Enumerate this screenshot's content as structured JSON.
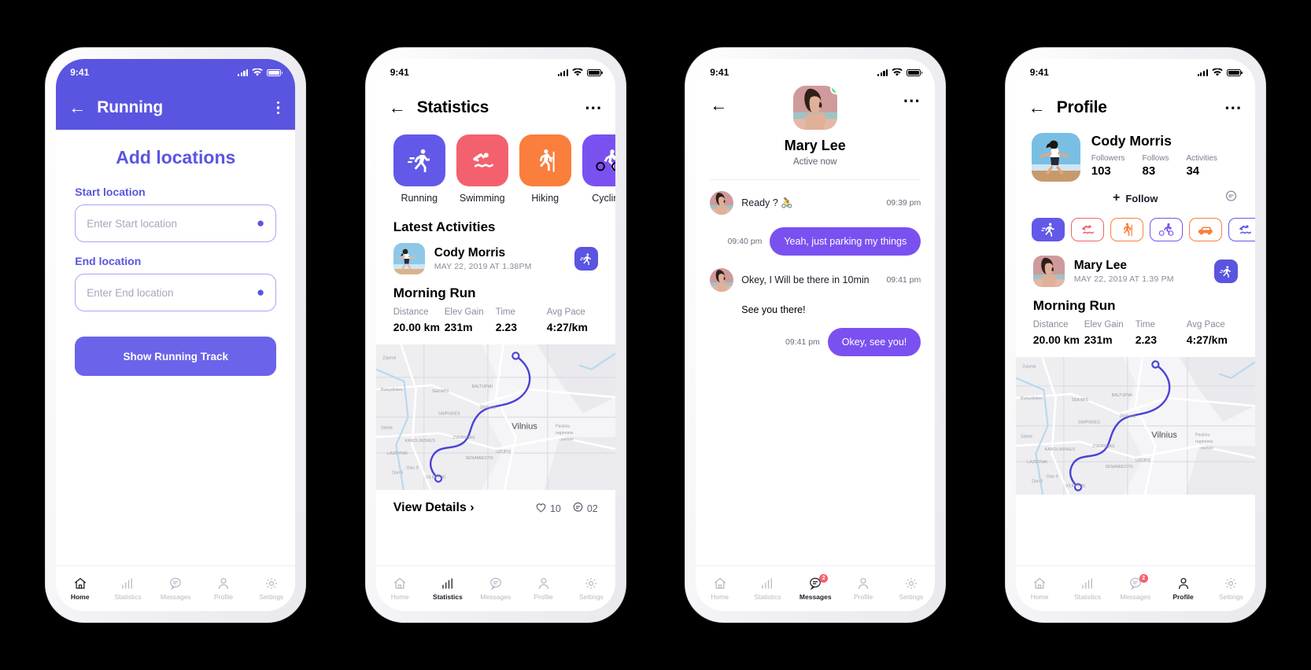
{
  "theme": {
    "primary": "#5a55e0",
    "button": "#6b63ea",
    "bubble": "#7a51f0",
    "red": "#f4616e",
    "orange": "#fa7e3c",
    "online": "#3ce68b"
  },
  "status_bar": {
    "time": "9:41"
  },
  "phone1": {
    "appbar": {
      "title": "Running"
    },
    "heading": "Add locations",
    "fields": [
      {
        "label": "Start location",
        "placeholder": "Enter Start location",
        "value": ""
      },
      {
        "label": "End location",
        "placeholder": "Enter End location",
        "value": ""
      }
    ],
    "submit_label": "Show Running Track",
    "nav": [
      {
        "label": "Home",
        "icon": "home-icon",
        "active": true
      },
      {
        "label": "Statistics",
        "icon": "bar-chart-icon",
        "active": false
      },
      {
        "label": "Messages",
        "icon": "chat-icon",
        "active": false
      },
      {
        "label": "Profile",
        "icon": "person-icon",
        "active": false
      },
      {
        "label": "Settings",
        "icon": "gear-icon",
        "active": false
      }
    ]
  },
  "phone2": {
    "appbar": {
      "title": "Statistics"
    },
    "categories": [
      {
        "label": "Running",
        "icon": "running-icon",
        "color": "#6259e8"
      },
      {
        "label": "Swimming",
        "icon": "swimming-icon",
        "color": "#f4616e"
      },
      {
        "label": "Hiking",
        "icon": "hiking-icon",
        "color": "#fa7e3c"
      },
      {
        "label": "Cycling",
        "icon": "cycling-icon",
        "color": "#7a51f0"
      }
    ],
    "section_title": "Latest Activities",
    "activity": {
      "user": "Cody Morris",
      "date": "MAY 22, 2019 AT 1.38PM",
      "type_icon": "running-icon",
      "title": "Morning Run",
      "stats": [
        {
          "key": "Distance",
          "value": "20.00 km"
        },
        {
          "key": "Elev Gain",
          "value": "231m"
        },
        {
          "key": "Time",
          "value": "2.23"
        },
        {
          "key": "Avg Pace",
          "value": "4:27/km"
        }
      ],
      "map_label": "Vilnius",
      "view_details": "View Details",
      "likes": "10",
      "comments": "02"
    },
    "nav": [
      {
        "label": "Home",
        "icon": "home-icon",
        "active": false
      },
      {
        "label": "Statistics",
        "icon": "bar-chart-icon",
        "active": true
      },
      {
        "label": "Messages",
        "icon": "chat-icon",
        "active": false
      },
      {
        "label": "Profile",
        "icon": "person-icon",
        "active": false
      },
      {
        "label": "Settings",
        "icon": "gear-icon",
        "active": false
      }
    ]
  },
  "phone3": {
    "contact": {
      "name": "Mary Lee",
      "status": "Active now"
    },
    "messages": [
      {
        "side": "in",
        "kind": "avatar",
        "text": "Ready ?",
        "emoji": "🚴",
        "time": "09:39 pm"
      },
      {
        "side": "out",
        "kind": "bubble",
        "text": "Yeah, just parking my things",
        "time": "09:40 pm"
      },
      {
        "side": "in",
        "kind": "avatar",
        "text": "Okey, I Will be there in 10min",
        "time": "09:41 pm"
      },
      {
        "side": "in",
        "kind": "plain",
        "text": "See you there!",
        "time": ""
      },
      {
        "side": "out",
        "kind": "bubble",
        "text": "Okey, see you!",
        "time": "09:41 pm"
      }
    ],
    "nav": [
      {
        "label": "Home",
        "icon": "home-icon",
        "active": false,
        "badge": ""
      },
      {
        "label": "Statistics",
        "icon": "bar-chart-icon",
        "active": false,
        "badge": ""
      },
      {
        "label": "Messages",
        "icon": "chat-icon",
        "active": true,
        "badge": "2"
      },
      {
        "label": "Profile",
        "icon": "person-icon",
        "active": false,
        "badge": ""
      },
      {
        "label": "Settings",
        "icon": "gear-icon",
        "active": false,
        "badge": ""
      }
    ]
  },
  "phone4": {
    "appbar": {
      "title": "Profile"
    },
    "user": {
      "name": "Cody Morris"
    },
    "stats": [
      {
        "key": "Followers",
        "value": "103"
      },
      {
        "key": "Follows",
        "value": "83"
      },
      {
        "key": "Activities",
        "value": "34"
      }
    ],
    "follow_label": "Follow",
    "chips": [
      {
        "icon": "running-icon",
        "color": "#6259e8",
        "filled": true
      },
      {
        "icon": "swimming-icon",
        "color": "#f4616e",
        "filled": false
      },
      {
        "icon": "hiking-icon",
        "color": "#fa7e3c",
        "filled": false
      },
      {
        "icon": "cycling-icon",
        "color": "#7a51f0",
        "filled": false
      },
      {
        "icon": "driving-icon",
        "color": "#fa7e3c",
        "filled": false
      },
      {
        "icon": "swimming-icon",
        "color": "#6259e8",
        "filled": false
      }
    ],
    "activity": {
      "user": "Mary Lee",
      "date": "MAY 22, 2019 AT 1.39 PM",
      "type_icon": "running-icon",
      "title": "Morning Run",
      "stats": [
        {
          "key": "Distance",
          "value": "20.00 km"
        },
        {
          "key": "Elev Gain",
          "value": "231m"
        },
        {
          "key": "Time",
          "value": "2.23"
        },
        {
          "key": "Avg Pace",
          "value": "4:27/km"
        }
      ],
      "map_label": "Vilnius"
    },
    "nav": [
      {
        "label": "Home",
        "icon": "home-icon",
        "active": false,
        "badge": ""
      },
      {
        "label": "Statistics",
        "icon": "bar-chart-icon",
        "active": false,
        "badge": ""
      },
      {
        "label": "Messages",
        "icon": "chat-icon",
        "active": false,
        "badge": "2"
      },
      {
        "label": "Profile",
        "icon": "person-icon",
        "active": true,
        "badge": ""
      },
      {
        "label": "Settings",
        "icon": "gear-icon",
        "active": false,
        "badge": ""
      }
    ]
  }
}
